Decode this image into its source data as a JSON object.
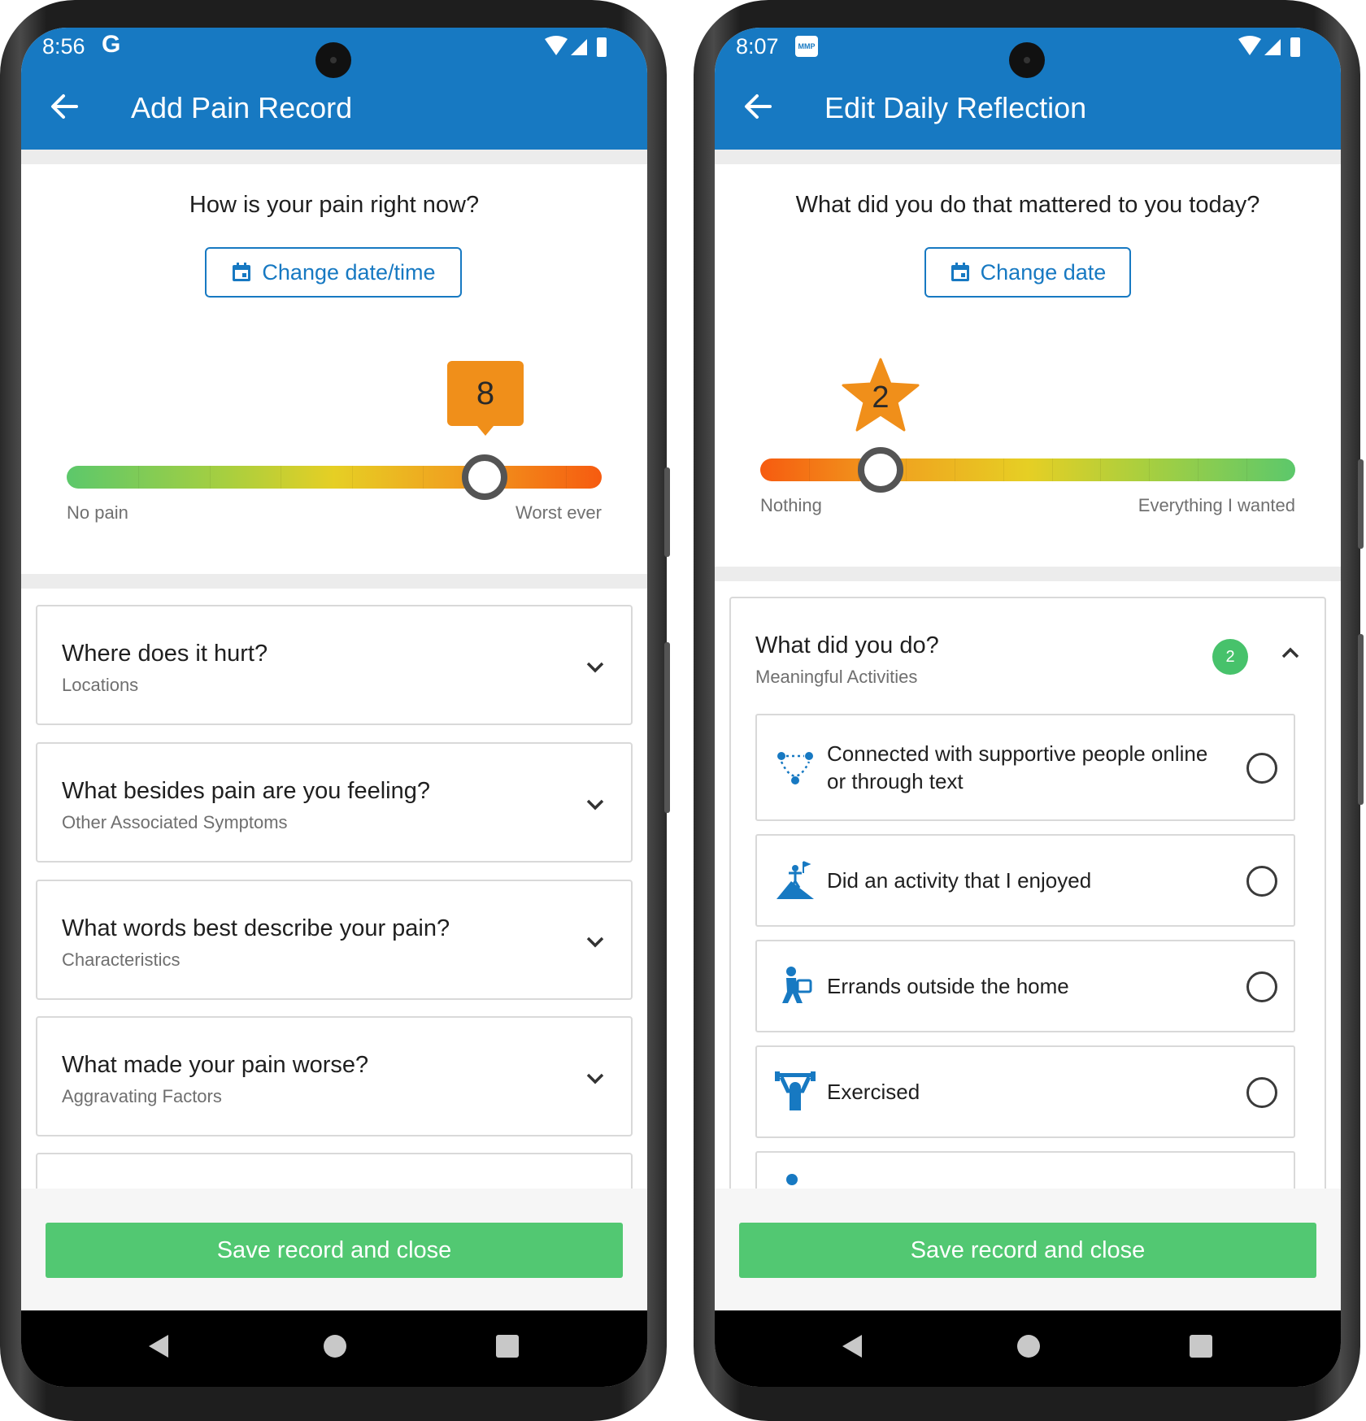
{
  "left_screen": {
    "status": {
      "time": "8:56",
      "app_icon": "G"
    },
    "app_bar": {
      "title": "Add Pain Record",
      "back_icon": "arrow-left-icon"
    },
    "question": "How is your pain right now?",
    "date_button": "Change date/time",
    "slider": {
      "value": "8",
      "level": 0.78,
      "min_label": "No pain",
      "max_label": "Worst ever"
    },
    "cards": [
      {
        "title": "Where does it hurt?",
        "subtitle": "Locations"
      },
      {
        "title": "What besides pain are you feeling?",
        "subtitle": "Other Associated Symptoms"
      },
      {
        "title": "What words best describe your pain?",
        "subtitle": "Characteristics"
      },
      {
        "title": "What made your pain worse?",
        "subtitle": "Aggravating Factors"
      }
    ],
    "save_button": "Save record and close"
  },
  "right_screen": {
    "status": {
      "time": "8:07",
      "app_icon": "MMP"
    },
    "app_bar": {
      "title": "Edit Daily Reflection",
      "back_icon": "arrow-left-icon"
    },
    "question": "What did you do that mattered to you today?",
    "date_button": "Change date",
    "slider": {
      "value": "2",
      "level": 0.22,
      "min_label": "Nothing",
      "max_label": "Everything I wanted"
    },
    "section": {
      "title": "What did you do?",
      "subtitle": "Meaningful Activities",
      "count": "2"
    },
    "activities": [
      {
        "label": "Connected with supportive people online or through text",
        "icon": "people-network-icon"
      },
      {
        "label": "Did an activity that I enjoyed",
        "icon": "mountain-summit-icon"
      },
      {
        "label": "Errands outside the home",
        "icon": "person-shopping-icon"
      },
      {
        "label": "Exercised",
        "icon": "weightlifting-icon"
      }
    ],
    "save_button": "Save record and close"
  },
  "colors": {
    "brand_blue": "#1779c2",
    "save_green": "#52c872",
    "bubble_orange": "#f08f1a",
    "badge_green": "#47c26b"
  }
}
